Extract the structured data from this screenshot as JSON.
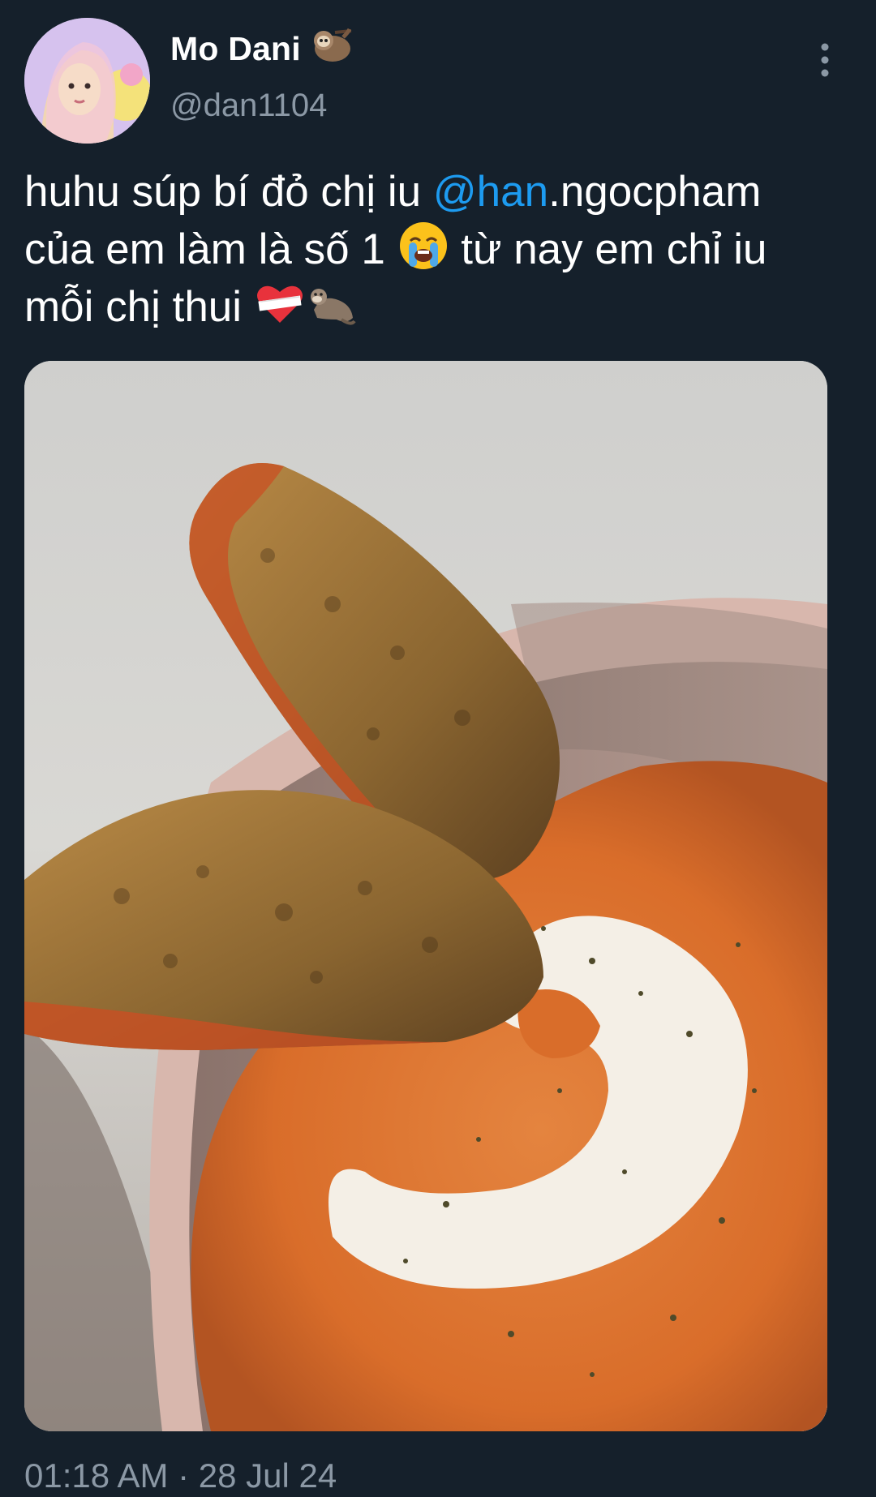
{
  "author": {
    "display_name": "Mo Dani",
    "handle": "@dan1104",
    "name_emoji": "sloth-icon"
  },
  "tweet": {
    "line1_prefix": "huhu súp bí đỏ chị iu ",
    "mention_linked": "@han",
    "line1_suffix": ".ngocpham",
    "line2_prefix": "của em làm là số 1 ",
    "line2_emoji": "loudly-crying-face-icon",
    "line2_suffix": " từ nay em chỉ iu",
    "line3_prefix": "mỗi chị thui ",
    "line3_emojis": [
      "mending-heart-icon",
      "otter-icon"
    ]
  },
  "media": {
    "icon": "photo-of-pumpkin-soup-with-bread"
  },
  "meta": {
    "timestamp": "01:18 AM · 28 Jul 24"
  },
  "colors": {
    "background": "#15202b",
    "link": "#1d9bf0",
    "secondary_text": "#8b98a5"
  }
}
